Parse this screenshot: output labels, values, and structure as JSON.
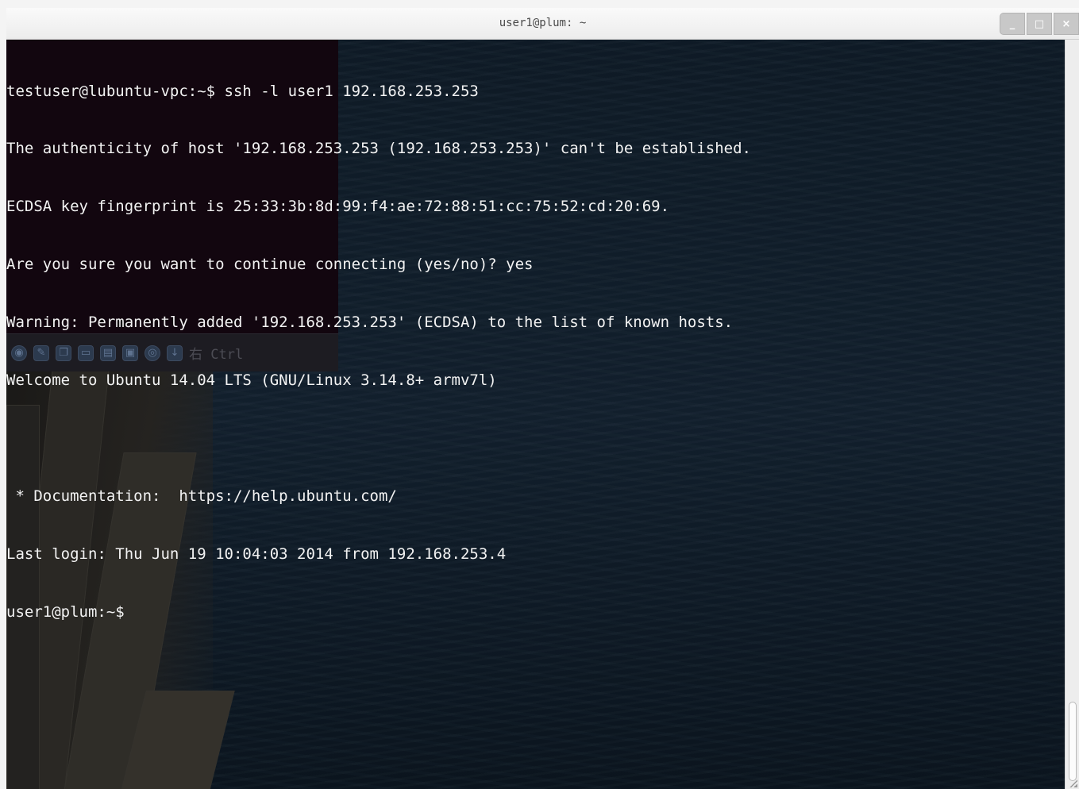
{
  "window": {
    "title": "user1@plum: ~",
    "controls": {
      "minimize": "_",
      "maximize": "□",
      "close": "×"
    }
  },
  "vbox_toolbar": {
    "icons": [
      "disc-icon",
      "pencil-icon",
      "windows-icon",
      "folder-icon",
      "network-icon",
      "usb-icon",
      "globe-icon",
      "download-arrow-icon"
    ],
    "host_key": "右 Ctrl"
  },
  "terminal": {
    "lines": [
      "testuser@lubuntu-vpc:~$ ssh -l user1 192.168.253.253",
      "The authenticity of host '192.168.253.253 (192.168.253.253)' can't be established.",
      "ECDSA key fingerprint is 25:33:3b:8d:99:f4:ae:72:88:51:cc:75:52:cd:20:69.",
      "Are you sure you want to continue connecting (yes/no)? yes",
      "Warning: Permanently added '192.168.253.253' (ECDSA) to the list of known hosts.",
      "Welcome to Ubuntu 14.04 LTS (GNU/Linux 3.14.8+ armv7l)",
      "",
      " * Documentation:  https://help.ubuntu.com/",
      "Last login: Thu Jun 19 10:04:03 2014 from 192.168.253.4",
      "user1@plum:~$"
    ]
  }
}
